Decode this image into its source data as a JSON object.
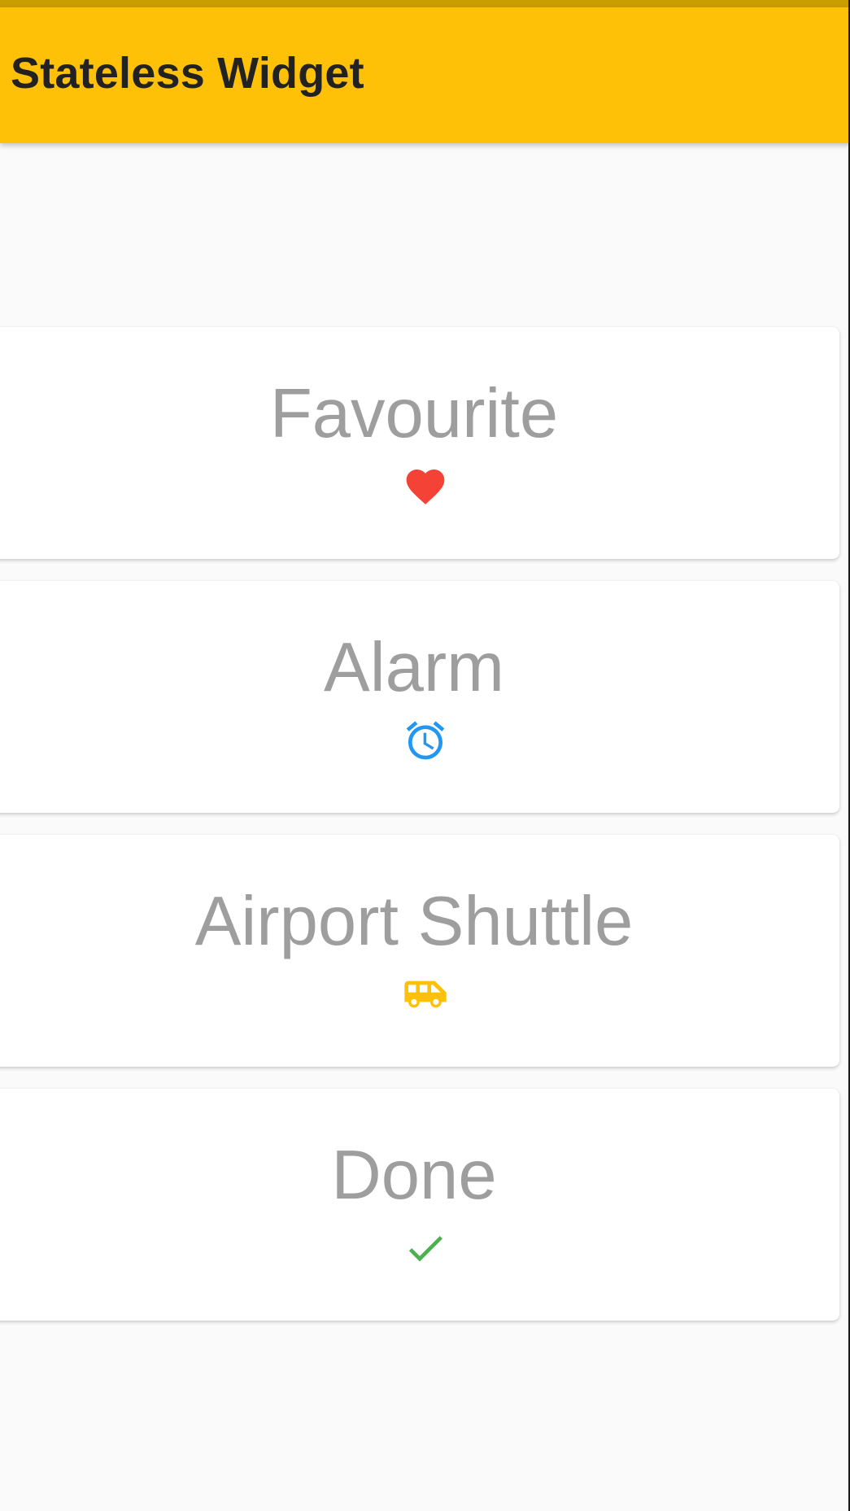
{
  "app_bar": {
    "title": "Stateless Widget",
    "color": "#ffc107"
  },
  "cards": [
    {
      "label": "Favourite",
      "icon": "heart-icon",
      "icon_color": "#f44336"
    },
    {
      "label": "Alarm",
      "icon": "alarm-icon",
      "icon_color": "#2196f3"
    },
    {
      "label": "Airport Shuttle",
      "icon": "airport-shuttle-icon",
      "icon_color": "#ffc107"
    },
    {
      "label": "Done",
      "icon": "done-icon",
      "icon_color": "#4caf50"
    }
  ]
}
